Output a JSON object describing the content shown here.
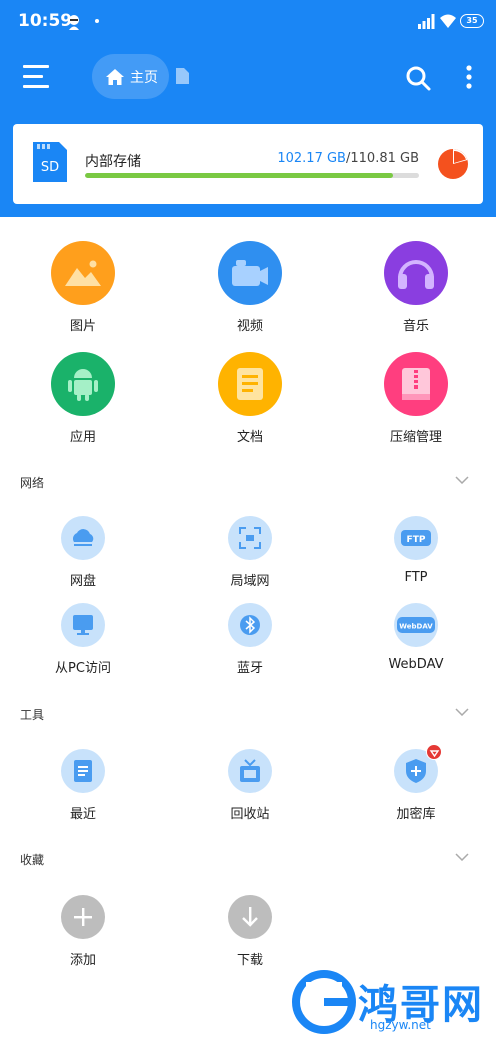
{
  "status_bar": {
    "time": "10:59",
    "battery": "35"
  },
  "toolbar": {
    "home_label": "主页"
  },
  "storage": {
    "name": "内部存储",
    "used": "102.17 GB",
    "separator": "/",
    "total": "110.81 GB",
    "used_fraction": 0.922,
    "badge": "SD"
  },
  "categories": [
    {
      "label": "图片",
      "icon": "image-icon",
      "color": "#ff9f1c"
    },
    {
      "label": "视频",
      "icon": "video-icon",
      "color": "#2f8ff0"
    },
    {
      "label": "音乐",
      "icon": "headphones-icon",
      "color": "#8a3ee0"
    },
    {
      "label": "应用",
      "icon": "android-icon",
      "color": "#1ab26a"
    },
    {
      "label": "文档",
      "icon": "document-icon",
      "color": "#ffb300"
    },
    {
      "label": "压缩管理",
      "icon": "archive-icon",
      "color": "#ff3e7f"
    }
  ],
  "sections": {
    "network": {
      "title": "网络",
      "items": [
        {
          "label": "网盘",
          "icon": "cloud-drive-icon"
        },
        {
          "label": "局域网",
          "icon": "lan-icon"
        },
        {
          "label": "FTP",
          "icon": "ftp-icon"
        },
        {
          "label": "从PC访问",
          "icon": "pc-access-icon"
        },
        {
          "label": "蓝牙",
          "icon": "bluetooth-icon"
        },
        {
          "label": "WebDAV",
          "icon": "webdav-icon"
        }
      ]
    },
    "tools": {
      "title": "工具",
      "items": [
        {
          "label": "最近",
          "icon": "recent-icon"
        },
        {
          "label": "回收站",
          "icon": "recycle-bin-icon"
        },
        {
          "label": "加密库",
          "icon": "vault-icon"
        }
      ]
    },
    "favorites": {
      "title": "收藏",
      "items": [
        {
          "label": "添加",
          "icon": "add-icon"
        },
        {
          "label": "下载",
          "icon": "download-icon"
        }
      ]
    }
  },
  "badge_text": {
    "ftp": "FTP",
    "webdav": "WebDAV"
  },
  "watermark": {
    "text": "鸿哥网",
    "url": "hgzyw.net"
  },
  "colors": {
    "primary": "#1a86f5",
    "bar_fill": "#7ac943",
    "pie": "#f4511e",
    "tool_circle": "#c8e2fb",
    "tool_icon": "#4a9cf0"
  }
}
